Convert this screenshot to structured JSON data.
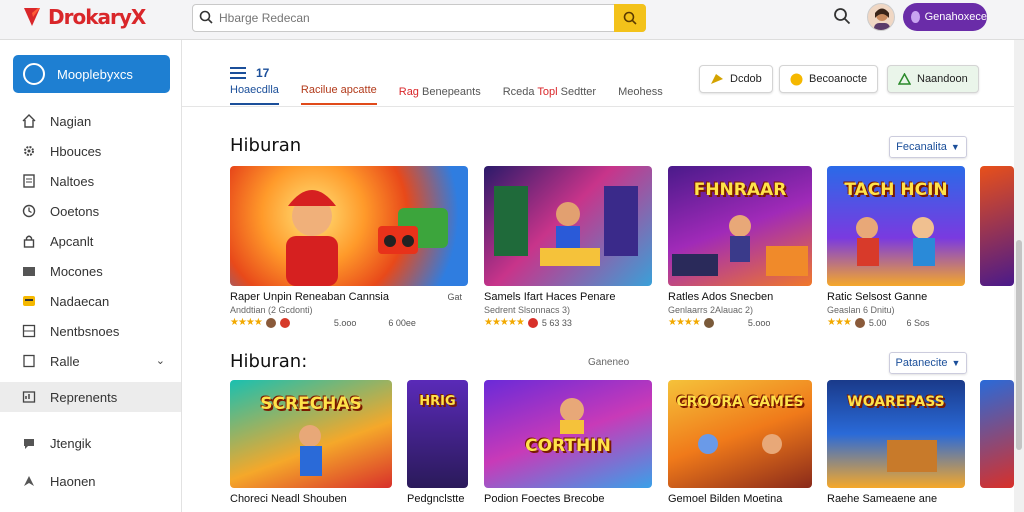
{
  "app": {
    "logo_text": "DrokaryX",
    "brand_color": "#d9262a"
  },
  "header": {
    "search_placeholder": "Hbarge Redecan",
    "signin_label": "Genahoxece"
  },
  "sidebar": {
    "primary_label": "Mooplebyxcs",
    "items": [
      {
        "label": "Nagian",
        "icon": "home-icon"
      },
      {
        "label": "Hbouces",
        "icon": "gear-icon"
      },
      {
        "label": "Naltoes",
        "icon": "document-icon"
      },
      {
        "label": "Ooetons",
        "icon": "clock-icon"
      },
      {
        "label": "Apcanlt",
        "icon": "lock-icon"
      },
      {
        "label": "Mocones",
        "icon": "folder-icon"
      },
      {
        "label": "Nadaecan",
        "icon": "badge-icon"
      },
      {
        "label": "Nentbsnoes",
        "icon": "grid-icon"
      },
      {
        "label": "Ralle",
        "icon": "file-icon"
      },
      {
        "label": "Reprenents",
        "icon": "chart-icon"
      },
      {
        "label": "Jtengik",
        "icon": "chat-icon"
      },
      {
        "label": "Haonen",
        "icon": "compass-icon"
      }
    ]
  },
  "toolbar": {
    "menu_count": "17",
    "tabs": [
      {
        "label": "Hoaecdlla"
      },
      {
        "label": "Racilue apcatte"
      },
      {
        "label_hl": "Rag",
        "label": "Benepeants"
      },
      {
        "label": "Rceda",
        "label_hl": "Topl",
        "label_rest": "Sedtter"
      },
      {
        "label": "Meohess"
      }
    ],
    "buttons": [
      {
        "label": "Dcdob"
      },
      {
        "label": "Becoanocte"
      },
      {
        "label": "Naandoon"
      }
    ]
  },
  "sections": [
    {
      "title": "Hiburan",
      "link_label": "Fecanalita",
      "cards": [
        {
          "title": "Raper Unpin Reneaban Cannsia",
          "sub": "Anddtian (2 Gcdonti)",
          "tag": "Gat",
          "count": "5.ooo",
          "right": "6 00ee",
          "theme": "hero"
        },
        {
          "title": "Samels Ifart Haces Penare",
          "sub": "Sedrent Slsonnacs 3)",
          "count": "5 63 33",
          "right": "",
          "theme": "arcade"
        },
        {
          "title": "Ratles Ados Snecben",
          "sub": "Genlaarrs 2Alauac 2)",
          "thumb_text": "FHNRAAR",
          "count": "",
          "right": "5.ooo",
          "theme": "purple"
        },
        {
          "title": "Ratic Selsost Ganne",
          "sub": "Geaslan 6 Dnitu)",
          "thumb_text": "TACH HCIN",
          "count": "5.00",
          "right": "6 Sos",
          "theme": "blue"
        }
      ]
    },
    {
      "title": "Hiburan:",
      "aux_label": "Ganeneo",
      "link_label": "Patanecite",
      "cards": [
        {
          "title": "Choreci Neadl Shouben",
          "thumb_text": "SCRECHAS",
          "theme": "teal"
        },
        {
          "title": "Pedgnclstte",
          "thumb_text": "HRIG",
          "theme": "violet"
        },
        {
          "title": "Podion Foectes Brecobe",
          "thumb_text": "CORTHIN",
          "theme": "magenta"
        },
        {
          "title": "Gemoel Bilden Moetina",
          "thumb_text": "CROORA GAMES",
          "theme": "orange"
        },
        {
          "title": "Raehe Sameaene ane",
          "thumb_text": "WOAREPASS",
          "theme": "stage"
        }
      ]
    }
  ]
}
